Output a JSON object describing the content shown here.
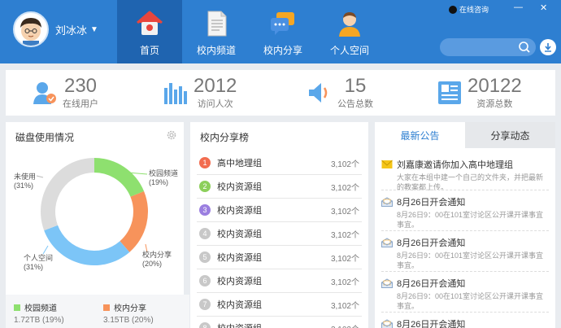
{
  "header": {
    "username": "刘冰冰",
    "nav": [
      {
        "label": "首页",
        "icon": "home-icon",
        "active": true
      },
      {
        "label": "校内频道",
        "icon": "document-icon",
        "active": false
      },
      {
        "label": "校内分享",
        "icon": "chat-share-icon",
        "active": false
      },
      {
        "label": "个人空间",
        "icon": "person-icon",
        "active": false
      }
    ],
    "online_consult": "在线咨询",
    "search_placeholder": ""
  },
  "stats": [
    {
      "value": "230",
      "label": "在线用户",
      "icon": "online-user-icon"
    },
    {
      "value": "2012",
      "label": "访问人次",
      "icon": "bar-chart-icon"
    },
    {
      "value": "15",
      "label": "公告总数",
      "icon": "speaker-icon"
    },
    {
      "value": "20122",
      "label": "资源总数",
      "icon": "resource-icon"
    }
  ],
  "disk": {
    "title": "磁盘使用情况",
    "segments": [
      {
        "name": "校园频道",
        "percent": "(19%)",
        "value": 19,
        "color": "#8ee06f"
      },
      {
        "name": "校内分享",
        "percent": "(20%)",
        "value": 20,
        "color": "#f7935b"
      },
      {
        "name": "个人空间",
        "percent": "(31%)",
        "value": 31,
        "color": "#7cc5f7"
      },
      {
        "name": "未使用",
        "percent": "(31%)",
        "value": 31,
        "color": "#dcdcdc"
      }
    ],
    "legend": [
      {
        "name": "校园频道",
        "detail": "1.72TB (19%)",
        "color": "#8ee06f"
      },
      {
        "name": "校内分享",
        "detail": "3.15TB (20%)",
        "color": "#f7935b"
      }
    ]
  },
  "ranking": {
    "title": "校内分享榜",
    "rows": [
      {
        "rank": "1",
        "name": "高中地理组",
        "count": "3,102个",
        "color": "#f26c4f"
      },
      {
        "rank": "2",
        "name": "校内资源组",
        "count": "3,102个",
        "color": "#8ccf5b"
      },
      {
        "rank": "3",
        "name": "校内资源组",
        "count": "3,102个",
        "color": "#9b7fe0"
      },
      {
        "rank": "4",
        "name": "校内资源组",
        "count": "3,102个",
        "color": "#c8c8c8"
      },
      {
        "rank": "5",
        "name": "校内资源组",
        "count": "3,102个",
        "color": "#c8c8c8"
      },
      {
        "rank": "6",
        "name": "校内资源组",
        "count": "3,102个",
        "color": "#c8c8c8"
      },
      {
        "rank": "7",
        "name": "校内资源组",
        "count": "3,102个",
        "color": "#c8c8c8"
      },
      {
        "rank": "8",
        "name": "校内资源组",
        "count": "3,102个",
        "color": "#c8c8c8"
      }
    ]
  },
  "notices": {
    "tabs": [
      {
        "label": "最新公告",
        "active": true
      },
      {
        "label": "分享动态",
        "active": false
      }
    ],
    "items": [
      {
        "title": "刘嘉康邀请你加入高中地理组",
        "body": "大家在本组中建一个自己的文件夹，并把最新的教案都上传。",
        "icon": "envelope-icon"
      },
      {
        "title": "8月26日开会通知",
        "body": "8月26日9：00在101室讨论区公开课开课事宜事宜。",
        "icon": "open-envelope-icon"
      },
      {
        "title": "8月26日开会通知",
        "body": "8月26日9：00在101室讨论区公开课开课事宜事宜。",
        "icon": "open-envelope-icon"
      },
      {
        "title": "8月26日开会通知",
        "body": "8月26日9：00在101室讨论区公开课开课事宜事宜。",
        "icon": "open-envelope-icon"
      },
      {
        "title": "8月26日开会通知",
        "body": "",
        "icon": "open-envelope-icon"
      }
    ]
  }
}
